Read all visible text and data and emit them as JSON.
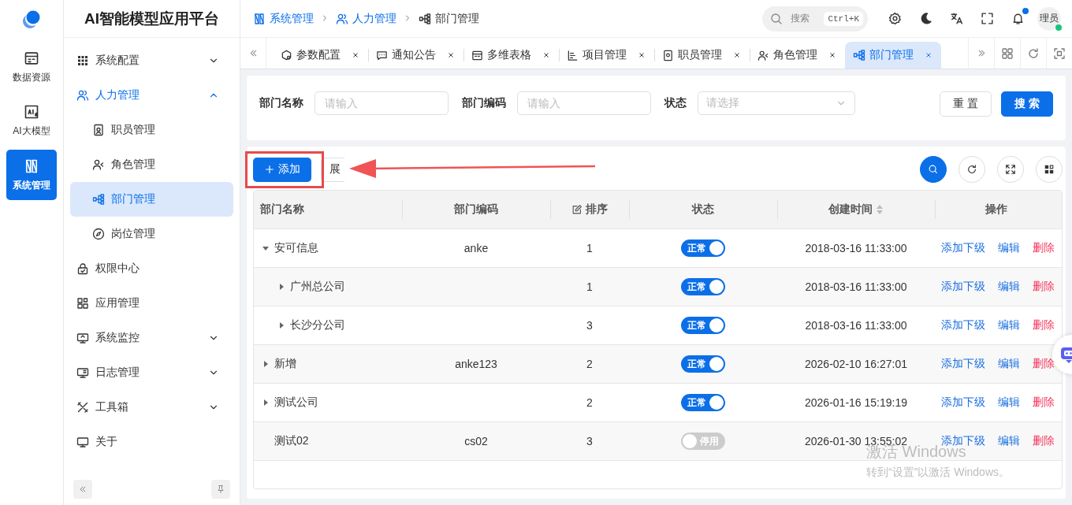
{
  "rail": {
    "items": [
      {
        "label": "数据资源",
        "selected": false
      },
      {
        "label": "AI大模型",
        "selected": false
      },
      {
        "label": "系统管理",
        "selected": true
      }
    ]
  },
  "sidebar": {
    "title": "AI智能模型应用平台",
    "items": [
      {
        "label": "系统配置",
        "selected": false,
        "expanded": false
      },
      {
        "label": "人力管理",
        "selected": true,
        "expanded": true,
        "children": [
          {
            "label": "职员管理",
            "selected": false
          },
          {
            "label": "角色管理",
            "selected": false
          },
          {
            "label": "部门管理",
            "selected": true
          },
          {
            "label": "岗位管理",
            "selected": false
          }
        ]
      },
      {
        "label": "权限中心",
        "selected": false
      },
      {
        "label": "应用管理",
        "selected": false
      },
      {
        "label": "系统监控",
        "selected": false,
        "expanded": false
      },
      {
        "label": "日志管理",
        "selected": false,
        "expanded": false
      },
      {
        "label": "工具箱",
        "selected": false,
        "expanded": false
      },
      {
        "label": "关于",
        "selected": false
      }
    ]
  },
  "header": {
    "breadcrumb": [
      "系统管理",
      "人力管理",
      "部门管理"
    ],
    "search": {
      "placeholder": "搜索",
      "shortcut": "Ctrl+K"
    },
    "notification_dot": true,
    "user": {
      "name": "理员",
      "online": true
    }
  },
  "tabs": [
    {
      "label": "参数配置",
      "selected": false
    },
    {
      "label": "通知公告",
      "selected": false
    },
    {
      "label": "多维表格",
      "selected": false
    },
    {
      "label": "项目管理",
      "selected": false
    },
    {
      "label": "职员管理",
      "selected": false
    },
    {
      "label": "角色管理",
      "selected": false
    },
    {
      "label": "部门管理",
      "selected": true
    }
  ],
  "filters": [
    {
      "label": "部门名称",
      "kind": "input",
      "placeholder": "请输入"
    },
    {
      "label": "部门编码",
      "kind": "input",
      "placeholder": "请输入"
    },
    {
      "label": "状态",
      "kind": "select",
      "placeholder": "请选择"
    }
  ],
  "filter_buttons": [
    {
      "label": "重 置",
      "kind": "default"
    },
    {
      "label": "搜 索",
      "kind": "primary"
    }
  ],
  "toolbar": {
    "add": "添加",
    "expand": "展"
  },
  "table": {
    "columns": [
      {
        "label": "部门名称",
        "kind": "plain"
      },
      {
        "label": "部门编码",
        "kind": "plain"
      },
      {
        "label": "排序",
        "kind": "editable"
      },
      {
        "label": "状态",
        "kind": "plain"
      },
      {
        "label": "创建时间",
        "kind": "sortable"
      },
      {
        "label": "操作",
        "kind": "plain"
      }
    ],
    "rows": [
      {
        "name": "安可信息",
        "code": "anke",
        "sort": "1",
        "status": {
          "on": true,
          "label": "正常"
        },
        "created": "2018-03-16 11:33:00",
        "actions": [
          {
            "label": "添加下级",
            "kind": "link"
          },
          {
            "label": "编辑",
            "kind": "link"
          },
          {
            "label": "删除",
            "kind": "danger"
          }
        ],
        "expanded": true,
        "children": [
          {
            "name": "广州总公司",
            "sort": "1",
            "status": {
              "on": true,
              "label": "正常"
            },
            "created": "2018-03-16 11:33:00",
            "actions": [
              {
                "label": "添加下级",
                "kind": "link"
              },
              {
                "label": "编辑",
                "kind": "link"
              },
              {
                "label": "删除",
                "kind": "danger"
              }
            ],
            "expanded": false
          },
          {
            "name": "长沙分公司",
            "sort": "3",
            "status": {
              "on": true,
              "label": "正常"
            },
            "created": "2018-03-16 11:33:00",
            "actions": [
              {
                "label": "添加下级",
                "kind": "link"
              },
              {
                "label": "编辑",
                "kind": "link"
              },
              {
                "label": "删除",
                "kind": "danger"
              }
            ],
            "expanded": false
          }
        ]
      },
      {
        "name": "新增",
        "code": "anke123",
        "sort": "2",
        "status": {
          "on": true,
          "label": "正常"
        },
        "created": "2026-02-10 16:27:01",
        "actions": [
          {
            "label": "添加下级",
            "kind": "link"
          },
          {
            "label": "编辑",
            "kind": "link"
          },
          {
            "label": "删除",
            "kind": "danger"
          }
        ],
        "expanded": false
      },
      {
        "name": "测试公司",
        "sort": "2",
        "status": {
          "on": true,
          "label": "正常"
        },
        "created": "2026-01-16 15:19:19",
        "actions": [
          {
            "label": "添加下级",
            "kind": "link"
          },
          {
            "label": "编辑",
            "kind": "link"
          },
          {
            "label": "删除",
            "kind": "danger"
          }
        ],
        "expanded": false
      },
      {
        "name": "测试02",
        "code": "cs02",
        "sort": "3",
        "status": {
          "on": false,
          "label": "停用"
        },
        "created": "2026-01-30 13:55:02",
        "actions": [
          {
            "label": "添加下级",
            "kind": "link"
          },
          {
            "label": "编辑",
            "kind": "link"
          },
          {
            "label": "删除",
            "kind": "danger"
          }
        ]
      }
    ]
  },
  "os_notice": {
    "title": "激活 Windows",
    "text": "转到“设置”以激活 Windows。"
  }
}
